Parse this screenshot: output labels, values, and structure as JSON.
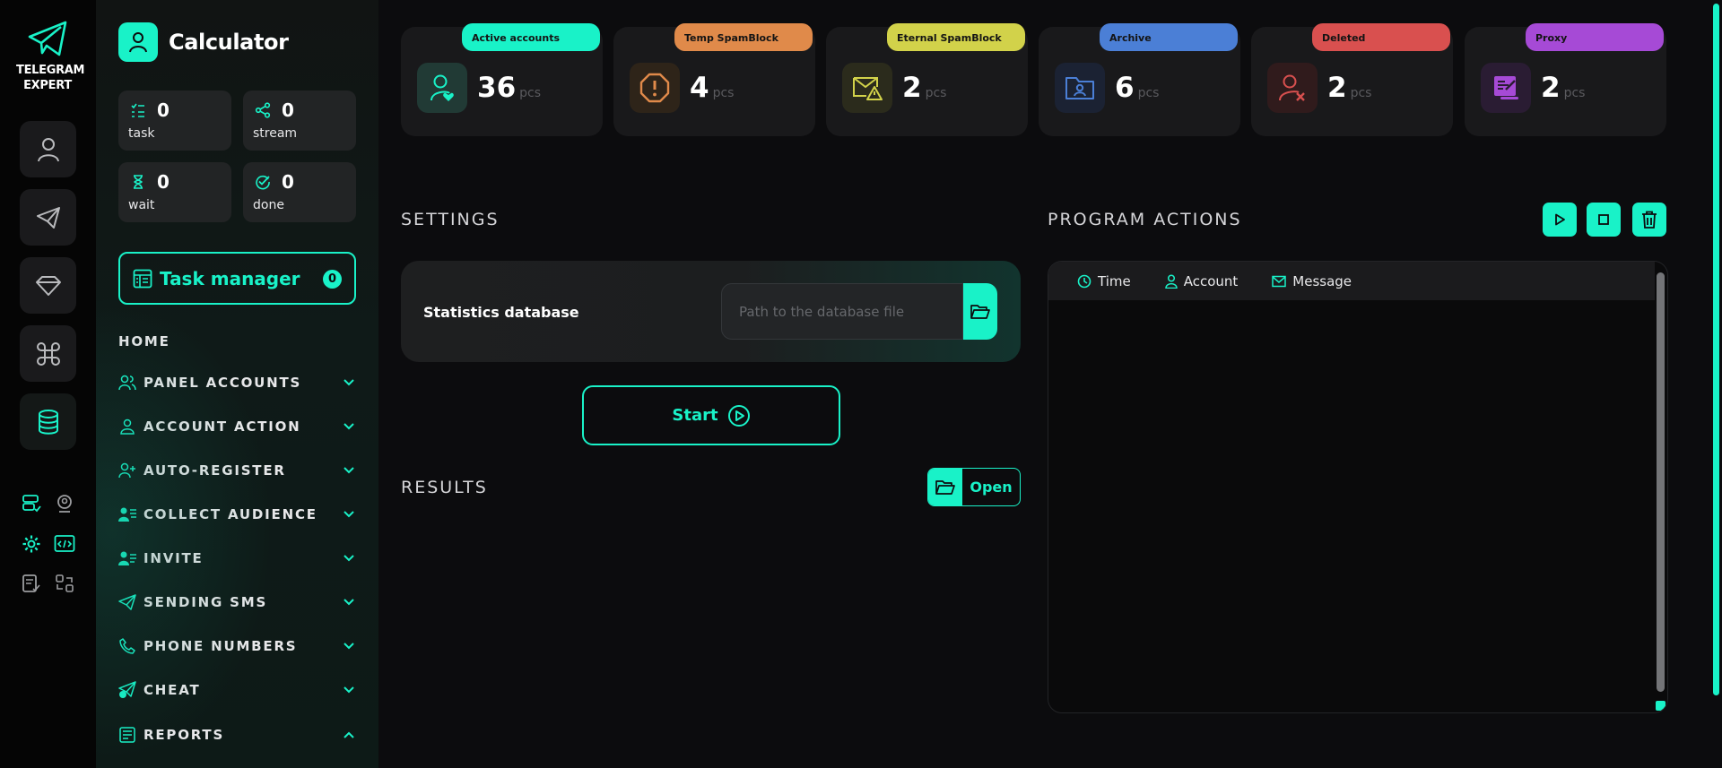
{
  "app": {
    "name_line1": "TELEGRAM",
    "name_line2": "EXPERT",
    "accent_color": "#19f2c8"
  },
  "rail": {
    "buttons": [
      "user-icon",
      "send-icon",
      "diamond-icon",
      "command-icon",
      "database-icon"
    ],
    "active": "database-icon",
    "mini_icons": [
      "server-check-icon",
      "user-location-icon",
      "settings-gear-icon",
      "code-window-icon",
      "report-check-icon",
      "swap-icon"
    ]
  },
  "sidebar": {
    "title": "Calculator",
    "stats": [
      {
        "value": "0",
        "label": "task",
        "icon": "checklist-icon"
      },
      {
        "value": "0",
        "label": "stream",
        "icon": "share-nodes-icon"
      },
      {
        "value": "0",
        "label": "wait",
        "icon": "hourglass-icon"
      },
      {
        "value": "0",
        "label": "done",
        "icon": "check-circle-icon"
      }
    ],
    "task_manager": {
      "label": "Task manager",
      "count": "0"
    },
    "home": "HOME",
    "nav": [
      {
        "label": "PANEL ACCOUNTS",
        "icon": "users-icon",
        "expanded": false
      },
      {
        "label": "ACCOUNT ACTION",
        "icon": "user-icon",
        "expanded": false
      },
      {
        "label": "AUTO-REGISTER",
        "icon": "user-plus-icon",
        "expanded": false
      },
      {
        "label": "COLLECT AUDIENCE",
        "icon": "user-list-icon",
        "expanded": false
      },
      {
        "label": "INVITE",
        "icon": "user-invite-icon",
        "expanded": false
      },
      {
        "label": "SENDING SMS",
        "icon": "send-icon",
        "expanded": false
      },
      {
        "label": "PHONE NUMBERS",
        "icon": "phone-icon",
        "expanded": false
      },
      {
        "label": "CHEAT",
        "icon": "send-plus-icon",
        "expanded": false
      },
      {
        "label": "REPORTS",
        "icon": "report-icon",
        "expanded": true
      }
    ]
  },
  "cards": [
    {
      "tag": "Active accounts",
      "value": "36",
      "unit": "pcs",
      "color": "#19f2c8",
      "icon": "user-heart-icon"
    },
    {
      "tag": "Temp SpamBlock",
      "value": "4",
      "unit": "pcs",
      "color": "#e08a4a",
      "icon": "alert-octagon-icon"
    },
    {
      "tag": "Eternal SpamBlock",
      "value": "2",
      "unit": "pcs",
      "color": "#d2d24a",
      "icon": "mail-warning-icon"
    },
    {
      "tag": "Archive",
      "value": "6",
      "unit": "pcs",
      "color": "#4b7fd6",
      "icon": "folder-user-icon"
    },
    {
      "tag": "Deleted",
      "value": "2",
      "unit": "pcs",
      "color": "#d9504f",
      "icon": "user-x-icon"
    },
    {
      "tag": "Proxy",
      "value": "2",
      "unit": "pcs",
      "color": "#a64ad6",
      "icon": "proxy-icon"
    }
  ],
  "settings": {
    "heading": "SETTINGS",
    "field_label": "Statistics database",
    "placeholder": "Path to the database file",
    "value": ""
  },
  "start_label": "Start",
  "results": {
    "heading": "RESULTS",
    "open_label": "Open"
  },
  "program_actions": {
    "heading": "PROGRAM ACTIONS",
    "columns": [
      {
        "label": "Time",
        "icon": "clock-icon"
      },
      {
        "label": "Account",
        "icon": "user-icon"
      },
      {
        "label": "Message",
        "icon": "mail-icon"
      }
    ],
    "rows": []
  }
}
